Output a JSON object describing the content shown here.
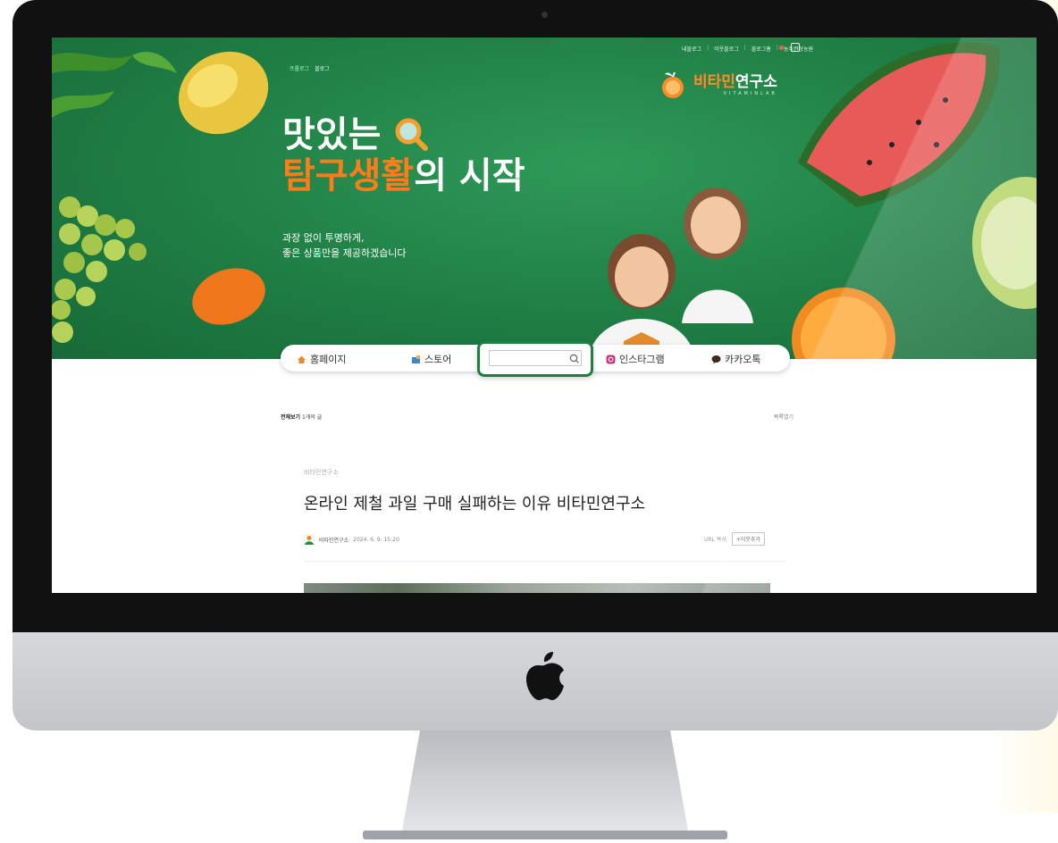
{
  "header": {
    "top_links": [
      "내블로그",
      "이웃블로그",
      "블로그홈",
      "농주권상농원"
    ],
    "breadcrumb": [
      "프롤로그",
      "블로그"
    ]
  },
  "brand": {
    "name_accent": "비타민",
    "name_rest": "연구소",
    "sub": "VITAMINLAB"
  },
  "hero": {
    "headline_line1": "맛있는",
    "headline_line2_accent": "탐구생활",
    "headline_line2_rest": "의 시작",
    "tagline_line1": "과장 없이 투명하게,",
    "tagline_line2": "좋은 상품만을 제공하겠습니다"
  },
  "nav": {
    "items": [
      {
        "label": "홈페이지",
        "icon": "home-icon"
      },
      {
        "label": "스토어",
        "icon": "store-icon"
      },
      {
        "label": "인스타그램",
        "icon": "instagram-icon"
      },
      {
        "label": "카카오톡",
        "icon": "kakaotalk-icon"
      }
    ],
    "search_value": ""
  },
  "list": {
    "heading": "전체보기",
    "count": "1개의 글",
    "toggle": "목록열기"
  },
  "post": {
    "category": "비타민연구소",
    "title": "온라인 제철 과일 구매 실패하는 이유 비타민연구소",
    "author": "비타민연구소",
    "date": "2024. 6. 9. 15:20",
    "url_copy": "URL 복사",
    "neighbor_add": "+이웃추가"
  },
  "colors": {
    "hero_green": "#1f7e44",
    "accent_orange": "#ff7b1c",
    "bezel": "#111111",
    "chin": "#c9cbce"
  }
}
